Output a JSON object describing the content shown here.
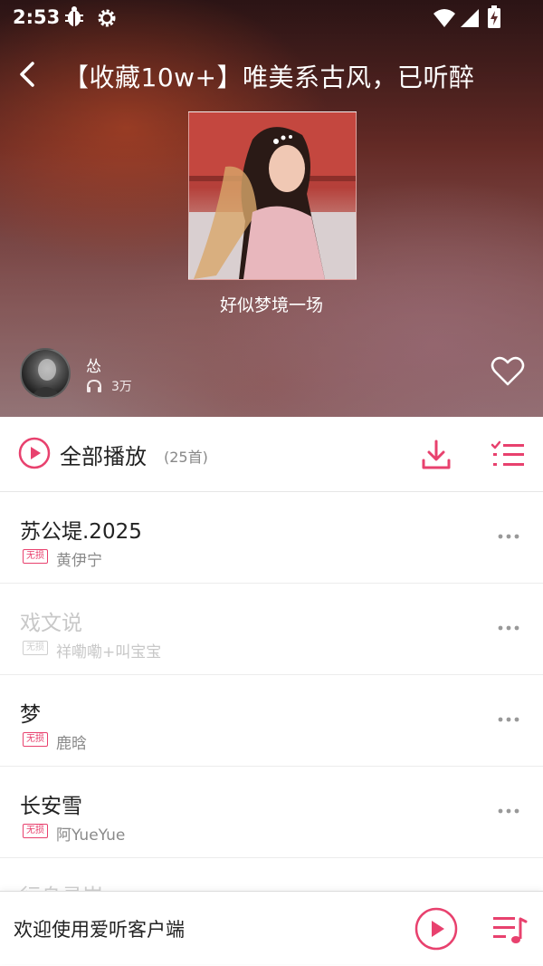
{
  "status_bar": {
    "time": "2:53",
    "icons": [
      "bug-icon",
      "gear-icon",
      "wifi-icon",
      "signal-icon",
      "battery-charging-icon"
    ]
  },
  "header": {
    "back_icon": "back-arrow-icon",
    "title": "【收藏10w+】唯美系古风，已听醉"
  },
  "playlist": {
    "cover_title": "好似梦境一场",
    "creator_name": "怂",
    "listen_count": "3万",
    "listen_icon": "headphones-icon",
    "favorite_icon": "heart-outline-icon"
  },
  "action_bar": {
    "play_all_label": "全部播放",
    "count_label": "(25首)",
    "icons": [
      "play-circle-icon",
      "download-icon",
      "multi-select-list-icon"
    ]
  },
  "songs": [
    {
      "title": "苏公堤.2025",
      "badge": "无损",
      "artist": "黄伊宁",
      "available": true
    },
    {
      "title": "戏文说",
      "badge": "无损",
      "artist": "祥嘞嘞+叫宝宝",
      "available": false
    },
    {
      "title": "梦",
      "badge": "无损",
      "artist": "鹿晗",
      "available": true
    },
    {
      "title": "长安雪",
      "badge": "无损",
      "artist": "阿YueYue",
      "available": true
    }
  ],
  "partial_song": {
    "title": "行舟寻岸"
  },
  "mini_player": {
    "text": "欢迎使用爱听客户端",
    "icons": [
      "play-circle-icon",
      "playlist-queue-icon"
    ]
  },
  "colors": {
    "accent": "#e8416e",
    "text_primary": "#222222",
    "text_secondary": "#8a8a8a",
    "text_disabled": "#c8c8c8"
  }
}
